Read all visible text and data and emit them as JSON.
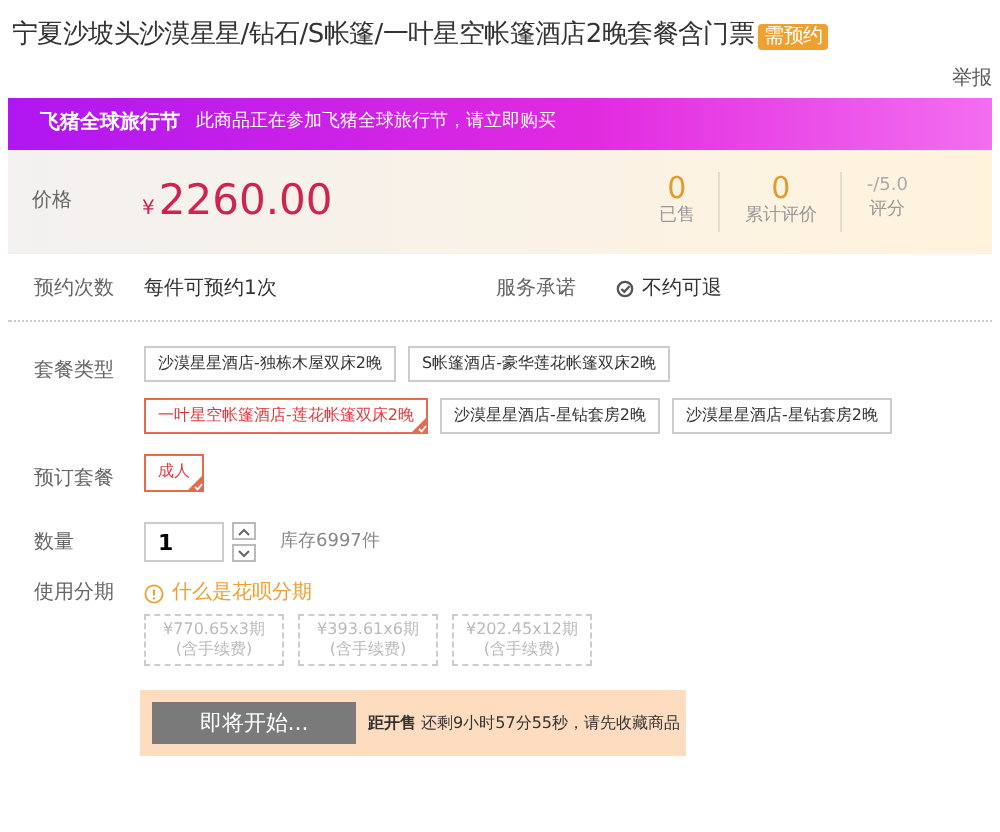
{
  "title": "宁夏沙坡头沙漠星星/钻石/S帐篷/一叶星空帐篷酒店2晚套餐含门票",
  "title_badge": "需预约",
  "report_link": "举报",
  "banner": {
    "title": "飞猪全球旅行节",
    "text": "此商品正在参加飞猪全球旅行节，请立即购买"
  },
  "price": {
    "label": "价格",
    "currency": "¥",
    "amount": "2260.00"
  },
  "stats": [
    {
      "value": "0",
      "label": "已售"
    },
    {
      "value": "0",
      "label": "累计评价"
    },
    {
      "value": "-/5.0",
      "label": "评分"
    }
  ],
  "booking": {
    "label": "预约次数",
    "value": "每件可预约1次",
    "service_label": "服务承诺",
    "service": "不约可退"
  },
  "package_type": {
    "label": "套餐类型",
    "options": [
      {
        "text": "沙漠星星酒店-独栋木屋双床2晚",
        "selected": false
      },
      {
        "text": "S帐篷酒店-豪华莲花帐篷双床2晚",
        "selected": false
      },
      {
        "text": "一叶星空帐篷酒店-莲花帐篷双床2晚",
        "selected": true
      },
      {
        "text": "沙漠星星酒店-星钻套房2晚",
        "selected": false
      },
      {
        "text": "沙漠星星酒店-星钻套房2晚",
        "selected": false
      }
    ]
  },
  "booking_package": {
    "label": "预订套餐",
    "options": [
      {
        "text": "成人",
        "selected": true
      }
    ]
  },
  "quantity": {
    "label": "数量",
    "value": "1",
    "stock": "库存6997件"
  },
  "installment": {
    "label": "使用分期",
    "help": "什么是花呗分期",
    "options": [
      {
        "amount": "¥770.65x3期",
        "note": "(含手续费)",
        "disabled": true
      },
      {
        "amount": "¥393.61x6期",
        "note": "(含手续费)",
        "disabled": true
      },
      {
        "amount": "¥202.45x12期",
        "note": "(含手续费)",
        "disabled": true
      }
    ]
  },
  "buy_bar": {
    "button": "即将开始...",
    "notice_label": "距开售",
    "notice": "还剩9小时57分55秒，请先收藏商品"
  }
}
